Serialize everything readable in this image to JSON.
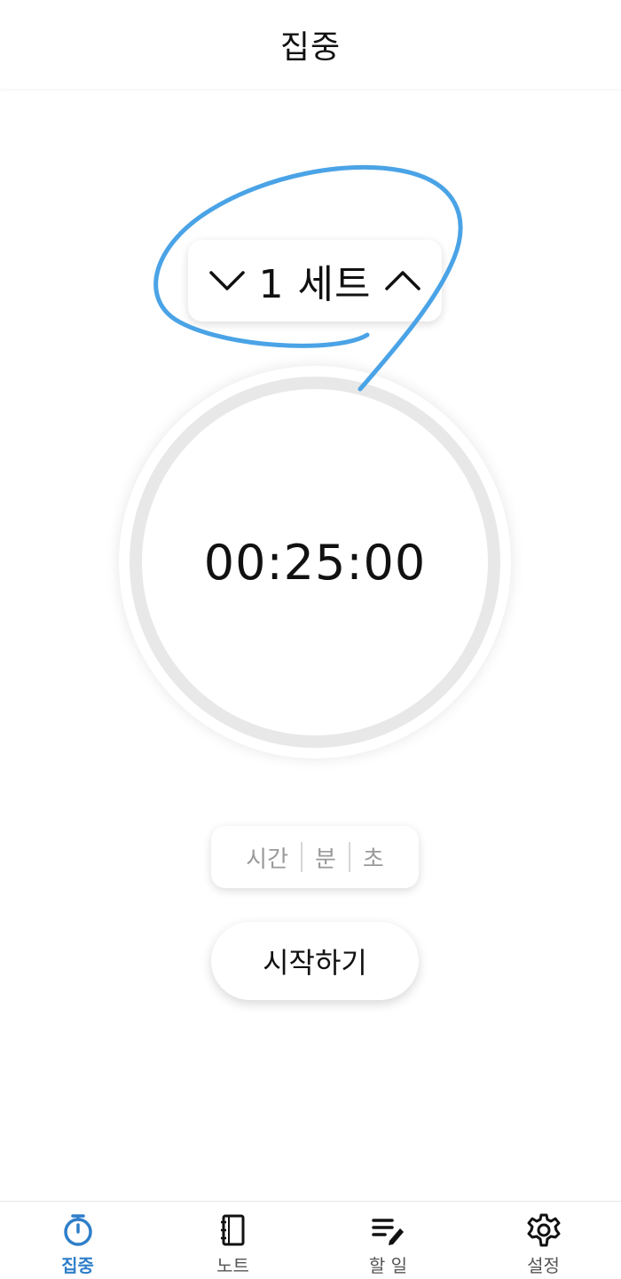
{
  "header": {
    "title": "집중"
  },
  "set_selector": {
    "label": "1 세트",
    "decrease_icon": "chevron-down-icon",
    "increase_icon": "chevron-up-icon"
  },
  "timer": {
    "display": "00:25:00"
  },
  "time_input": {
    "hours_placeholder": "시간",
    "minutes_placeholder": "분",
    "seconds_placeholder": "초"
  },
  "start_button": {
    "label": "시작하기"
  },
  "tabbar": {
    "active_color": "#2f7fc9",
    "tabs": [
      {
        "label": "집중",
        "icon": "stopwatch-icon",
        "active": true
      },
      {
        "label": "노트",
        "icon": "notebook-icon",
        "active": false
      },
      {
        "label": "할 일",
        "icon": "todo-list-icon",
        "active": false
      },
      {
        "label": "설정",
        "icon": "gear-icon",
        "active": false
      }
    ]
  },
  "annotation": {
    "color": "#4aa3e6"
  }
}
